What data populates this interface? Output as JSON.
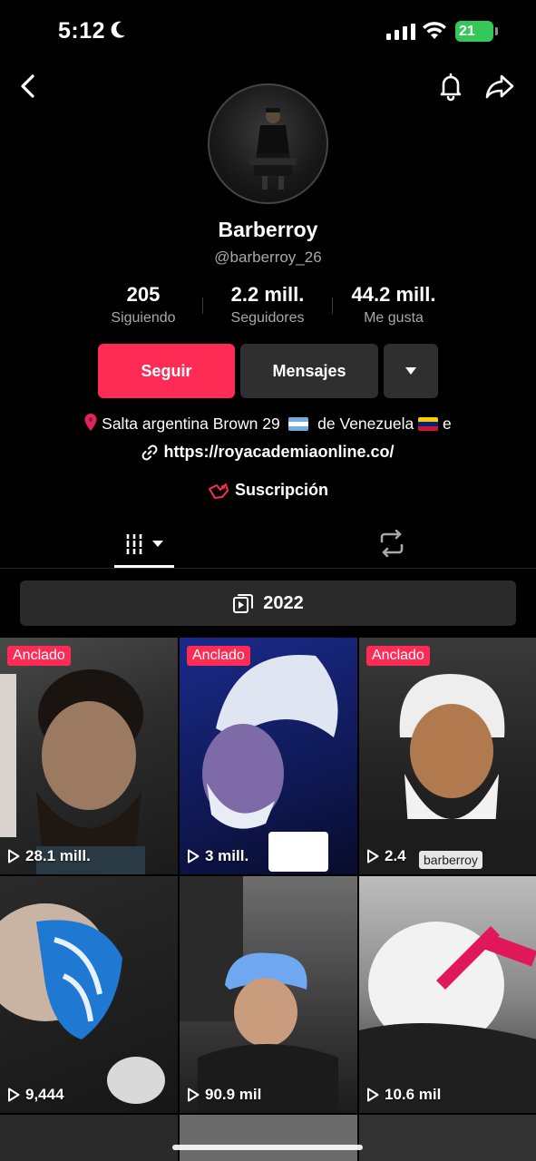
{
  "status_bar": {
    "time": "5:12",
    "battery": "21"
  },
  "profile": {
    "display_name": "Barberroy",
    "username": "@barberroy_26",
    "stats": [
      {
        "value": "205",
        "label": "Siguiendo"
      },
      {
        "value": "2.2 mill.",
        "label": "Seguidores"
      },
      {
        "value": "44.2 mill.",
        "label": "Me gusta"
      }
    ],
    "buttons": {
      "follow": "Seguir",
      "messages": "Mensajes"
    },
    "bio": {
      "text_before": "Salta argentina Brown 29",
      "text_middle": "de Venezuela",
      "text_after": "e"
    },
    "link": "https://royacademiaonline.co/",
    "subscription": "Suscripción"
  },
  "playlist": {
    "label": "2022"
  },
  "colors": {
    "accent": "#fe2c55",
    "button_dark": "#2f2f2f",
    "muted_text": "#a8a8a8"
  },
  "videos": [
    {
      "pinned_label": "Anclado",
      "views": "28.1 mill."
    },
    {
      "pinned_label": "Anclado",
      "views": "3 mill."
    },
    {
      "pinned_label": "Anclado",
      "views": "2.4",
      "tag": "barberroy"
    },
    {
      "views": "9,444"
    },
    {
      "views": "90.9 mil"
    },
    {
      "views": "10.6 mil"
    }
  ]
}
